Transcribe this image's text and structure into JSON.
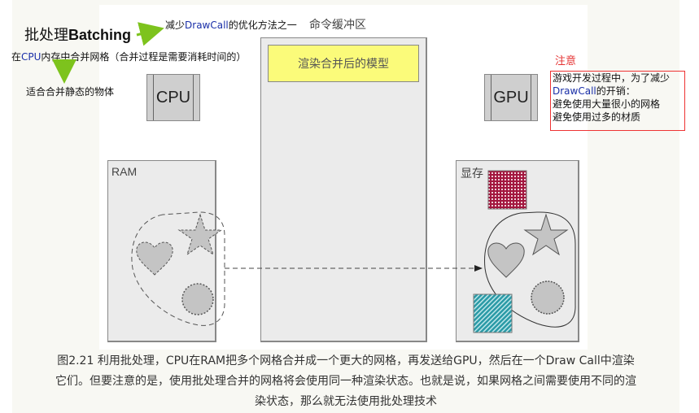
{
  "header": {
    "title_cn": "批处理",
    "title_en": "Batching",
    "subtitle_prefix": "减少",
    "subtitle_highlight": "DrawCall",
    "subtitle_suffix": "的优化方法之一",
    "merge_note_prefix": "在",
    "merge_note_highlight": "CPU",
    "merge_note_suffix": "内存中合并网格（合并过程是需要消耗时间的）",
    "suitability_note": "适合合并静态的物体"
  },
  "diagram": {
    "command_buffer_label": "命令缓冲区",
    "merged_model_label": "渲染合并后的模型",
    "cpu_label": "CPU",
    "gpu_label": "GPU",
    "ram_label": "RAM",
    "vram_label": "显存",
    "ram_shapes": [
      "heart",
      "star",
      "gear"
    ],
    "vram_shapes": [
      "checker-texture",
      "heart",
      "star",
      "gear",
      "striped-texture"
    ],
    "colors": {
      "arrow_green": "#7dc31d",
      "merged_model_fill": "#fbfb7a",
      "checker_texture": "#a3173f",
      "striped_texture": "#2a9aa6",
      "shape_fill": "#c4c4c4",
      "warning_red": "#e53333"
    }
  },
  "warning": {
    "label": "注意",
    "line1": "游戏开发过程中，为了减少",
    "line2_highlight": "DrawCall",
    "line2_suffix": "的开销：",
    "line3": "避免使用大量很小的网格",
    "line4": "避免使用过多的材质"
  },
  "caption": {
    "line1": "图2.21 利用批处理，CPU在RAM把多个网格合并成一个更大的网格，再发送给GPU，然后在一个Draw Call中渲染",
    "line2": "它们。但要注意的是，使用批处理合并的网格将会使用同一种渲染状态。也就是说，如果网格之间需要使用不同的渲",
    "line3": "染状态，那么就无法使用批处理技术"
  }
}
